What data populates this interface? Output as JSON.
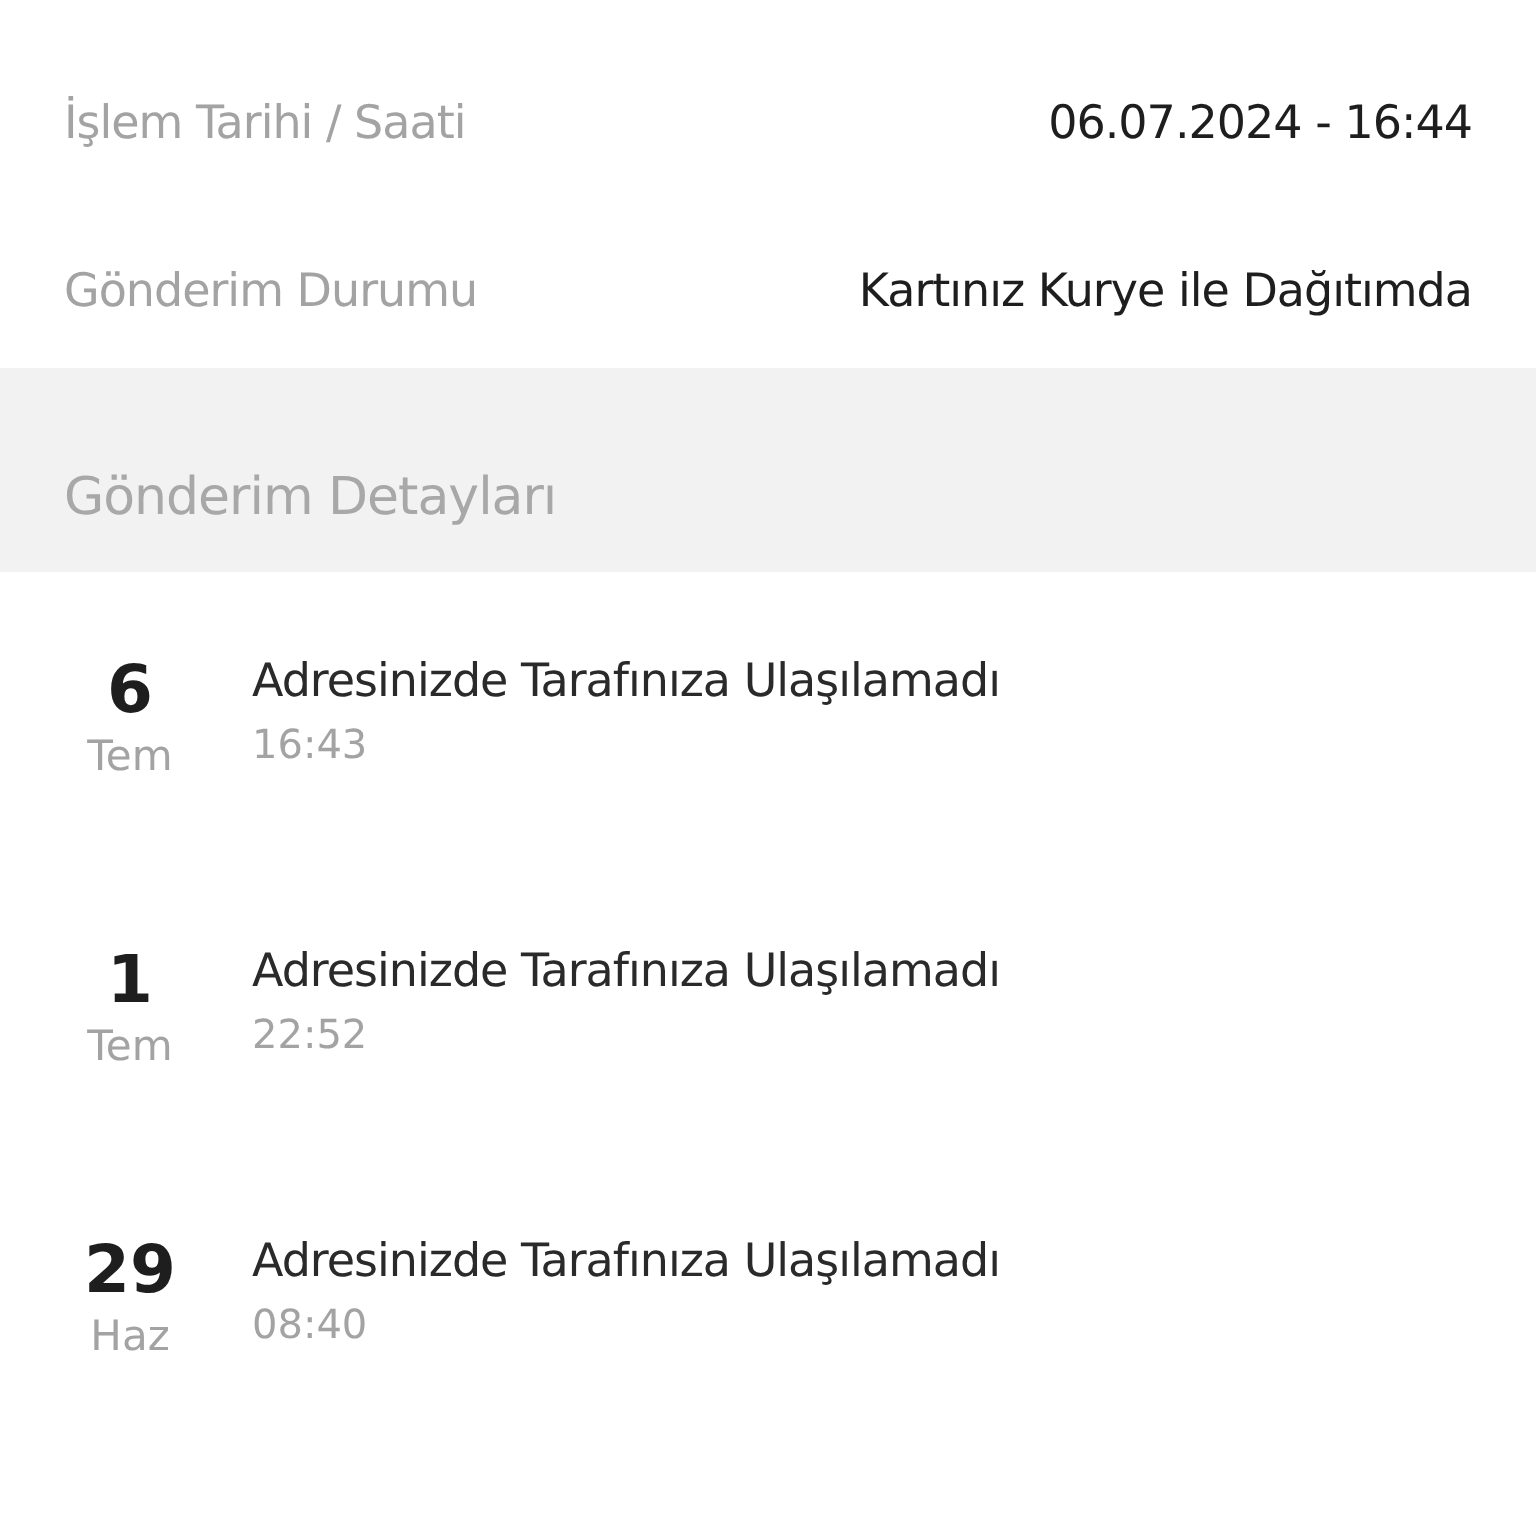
{
  "info_rows": [
    {
      "label": "İşlem Tarihi / Saati",
      "value": "06.07.2024 - 16:44"
    },
    {
      "label": "Gönderim Durumu",
      "value": "Kartınız Kurye ile Dağıtımda"
    }
  ],
  "section": {
    "title": "Gönderim Detayları"
  },
  "events": [
    {
      "day": "6",
      "month": "Tem",
      "title": "Adresinizde Tarafınıza Ulaşılamadı",
      "time": "16:43"
    },
    {
      "day": "1",
      "month": "Tem",
      "title": "Adresinizde Tarafınıza Ulaşılamadı",
      "time": "22:52"
    },
    {
      "day": "29",
      "month": "Haz",
      "title": "Adresinizde Tarafınıza Ulaşılamadı",
      "time": "08:40"
    }
  ]
}
